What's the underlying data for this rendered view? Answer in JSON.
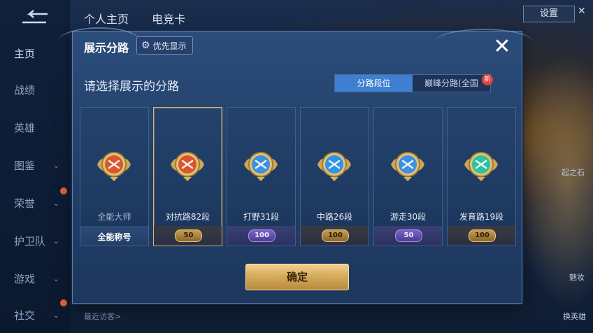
{
  "background": {
    "tabs": [
      "个人主页",
      "电竞卡"
    ],
    "settings_label": "设置",
    "sidebar": [
      {
        "label": "主页",
        "chevron": false,
        "active": true
      },
      {
        "label": "战绩",
        "chevron": false
      },
      {
        "label": "英雄",
        "chevron": false
      },
      {
        "label": "图鉴",
        "chevron": true
      },
      {
        "label": "荣誉",
        "chevron": true
      },
      {
        "label": "护卫队",
        "chevron": true
      },
      {
        "label": "游戏",
        "chevron": true
      },
      {
        "label": "社交",
        "chevron": true
      }
    ],
    "recent_visitors": "最近访客>",
    "right_labels": [
      "起之石",
      "魅妆",
      "换英雄"
    ]
  },
  "modal": {
    "title": "展示分路",
    "priority_button": "优先显示",
    "prompt": "请选择展示的分路",
    "segments": [
      "分路段位",
      "巅峰分路(全国"
    ],
    "new_badge": "新",
    "cards": [
      {
        "label": "全能大师",
        "footer_text": "全能称号",
        "level": "",
        "pill": "",
        "selected": false,
        "emblem_color": "#d9572e"
      },
      {
        "label": "对抗路82段",
        "footer_text": "",
        "level": "50",
        "pill": "gold",
        "selected": true,
        "emblem_color": "#d9572e"
      },
      {
        "label": "打野31段",
        "footer_text": "",
        "level": "100",
        "pill": "purple",
        "selected": false,
        "emblem_color": "#3e8fe0"
      },
      {
        "label": "中路26段",
        "footer_text": "",
        "level": "100",
        "pill": "gold",
        "selected": false,
        "emblem_color": "#2f93e6"
      },
      {
        "label": "游走30段",
        "footer_text": "",
        "level": "50",
        "pill": "purple",
        "selected": false,
        "emblem_color": "#3e8fe0"
      },
      {
        "label": "发育路19段",
        "footer_text": "",
        "level": "100",
        "pill": "gold",
        "selected": false,
        "emblem_color": "#2cc2a0"
      }
    ],
    "confirm_label": "确定"
  }
}
